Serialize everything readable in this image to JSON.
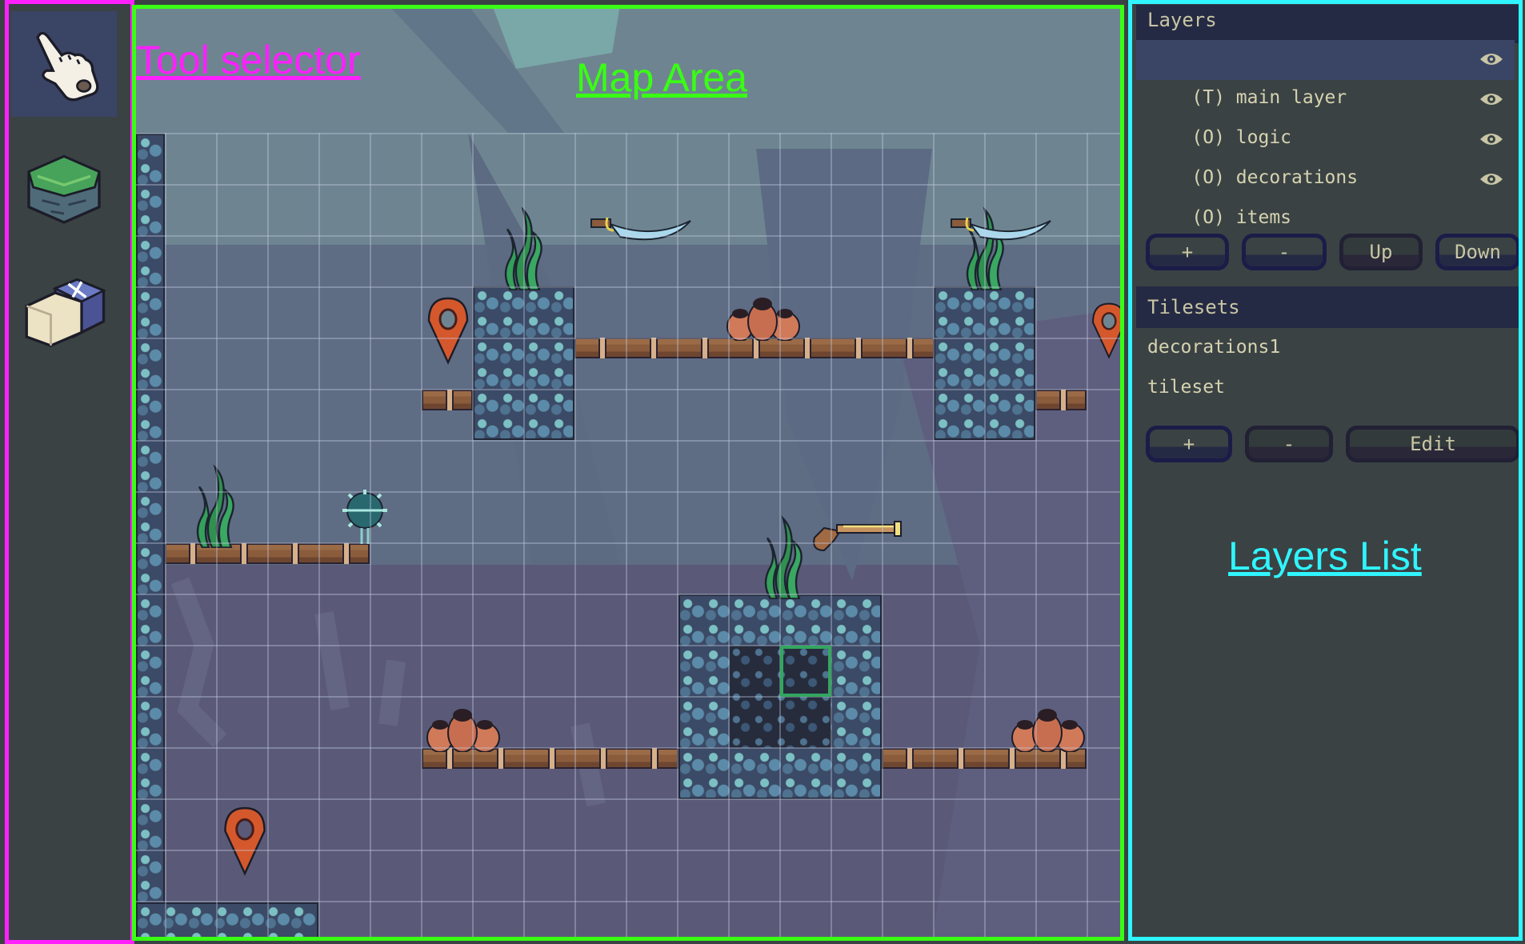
{
  "annotations": {
    "tool_selector": "Tool selector",
    "map_area": "Map Area",
    "layers_list": "Layers List"
  },
  "colors": {
    "tool_selector_outline": "#ff1fff",
    "map_area_outline": "#39ff14",
    "layers_list_outline": "#2ff5ff",
    "panel_bg": "#3a4244",
    "header_bg": "#252a44",
    "selected_row_bg": "#3a4464",
    "text": "#d6d3b0",
    "selection_cursor": "#33a660"
  },
  "tools": [
    {
      "name": "pointer",
      "icon": "pointing-hand-icon",
      "active": true
    },
    {
      "name": "paint-tile",
      "icon": "grass-block-icon",
      "active": false
    },
    {
      "name": "eraser",
      "icon": "eraser-icon",
      "active": false
    }
  ],
  "layers": {
    "title": "Layers",
    "items": [
      {
        "label": "(T) main layer",
        "visible": true,
        "selected": true
      },
      {
        "label": "(O) logic",
        "visible": true,
        "selected": false
      },
      {
        "label": "(O) decorations",
        "visible": true,
        "selected": false
      },
      {
        "label": "(O) items",
        "visible": true,
        "selected": false
      }
    ],
    "buttons": {
      "add": "+",
      "remove": "-",
      "up": "Up",
      "down": "Down"
    }
  },
  "tilesets": {
    "title": "Tilesets",
    "items": [
      "decorations1",
      "tileset"
    ],
    "buttons": {
      "add": "+",
      "remove": "-",
      "edit": "Edit"
    }
  },
  "map": {
    "objects": [
      "seaweed",
      "sword",
      "location-pin",
      "pots",
      "spike-ball",
      "flintlock-pistol",
      "wooden-plank",
      "stone-block"
    ]
  }
}
